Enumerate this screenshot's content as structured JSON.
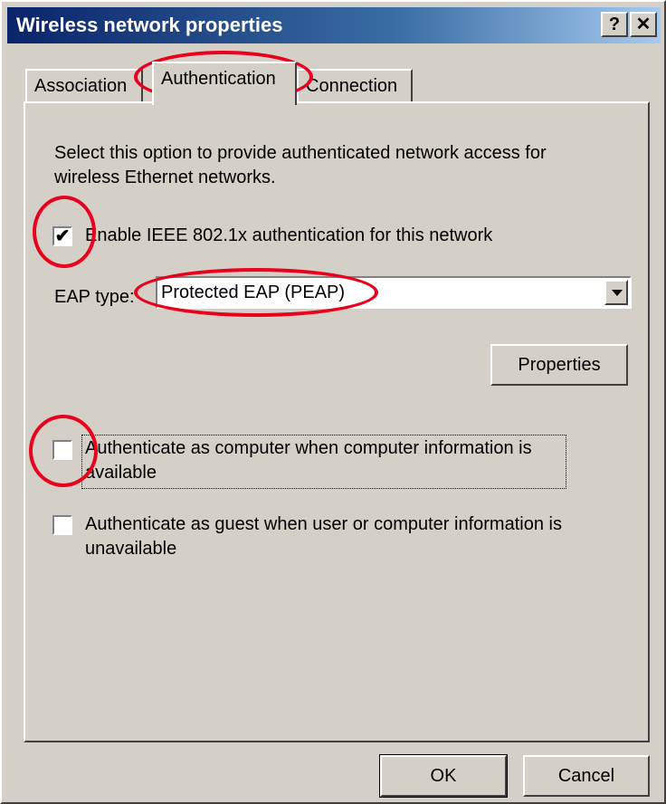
{
  "window": {
    "title": "Wireless network properties",
    "help_button": "?",
    "close_button": "✕"
  },
  "tabs": [
    {
      "label": "Association",
      "active": false
    },
    {
      "label": "Authentication",
      "active": true
    },
    {
      "label": "Connection",
      "active": false
    }
  ],
  "authentication": {
    "description": "Select this option to provide authenticated network access for wireless Ethernet networks.",
    "enable_8021x": {
      "label": "Enable IEEE 802.1x authentication for this network",
      "checked": true,
      "check_glyph": "✔"
    },
    "eap_type": {
      "label": "EAP type:",
      "value": "Protected EAP (PEAP)"
    },
    "properties_button": "Properties",
    "auth_as_computer": {
      "label": "Authenticate as computer when computer information is available",
      "checked": false
    },
    "auth_as_guest": {
      "label": "Authenticate as guest when user or computer information is unavailable",
      "checked": false
    }
  },
  "footer": {
    "ok_label": "OK",
    "cancel_label": "Cancel"
  },
  "annotation": {
    "highlight_color": "#e8001c"
  }
}
